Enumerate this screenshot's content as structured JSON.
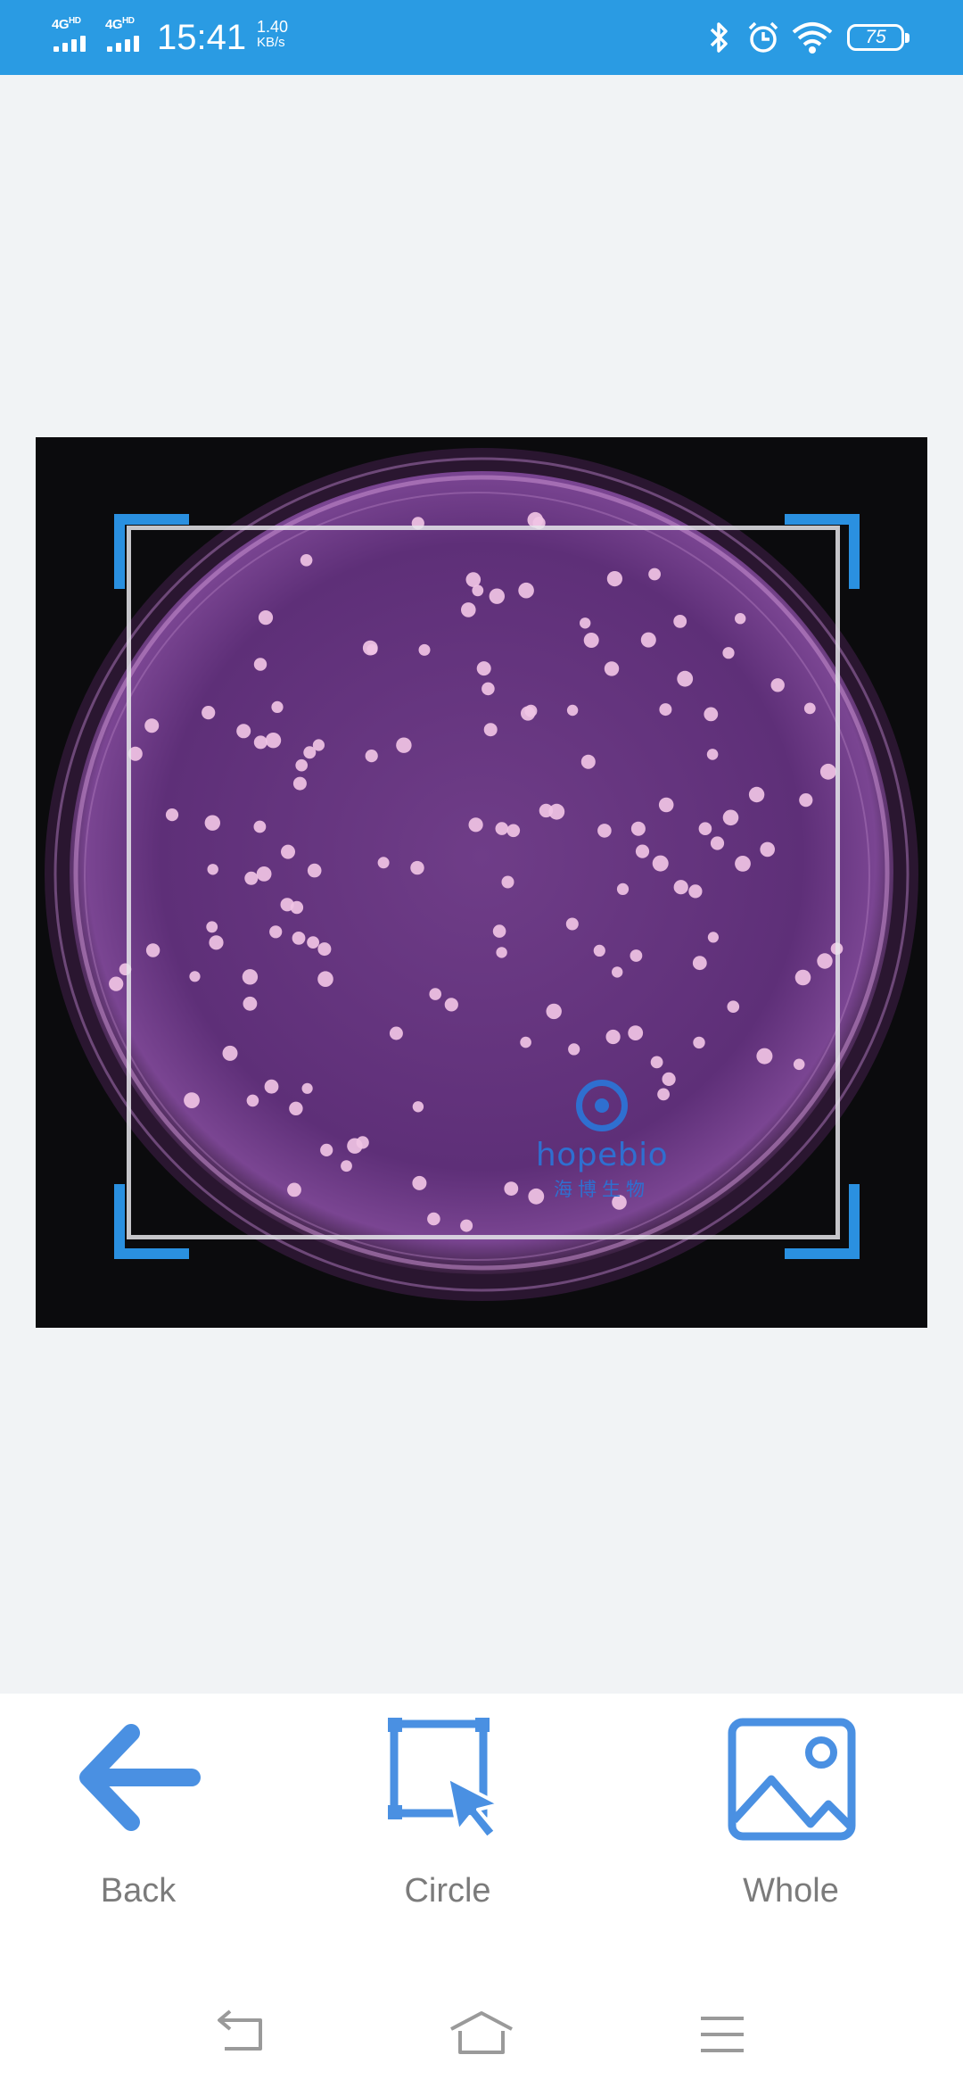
{
  "status_bar": {
    "network_1": "4G",
    "network_1_sup": "HD",
    "network_2": "4G",
    "network_2_sup": "HD",
    "time": "15:41",
    "speed_value": "1.40",
    "speed_unit": "KB/s",
    "battery": "75",
    "icons": [
      "bluetooth-icon",
      "alarm-icon",
      "wifi-icon",
      "battery-icon"
    ],
    "background": "#2a9be3"
  },
  "image": {
    "watermark_brand": "hopebio",
    "watermark_cn": "海博生物",
    "crop_handle_color": "#2a90e0"
  },
  "toolbar": {
    "back_label": "Back",
    "circle_label": "Circle",
    "whole_label": "Whole",
    "icon_color": "#4a90e2"
  },
  "nav_bar": {
    "icons": [
      "back-nav-icon",
      "home-nav-icon",
      "menu-nav-icon"
    ]
  }
}
